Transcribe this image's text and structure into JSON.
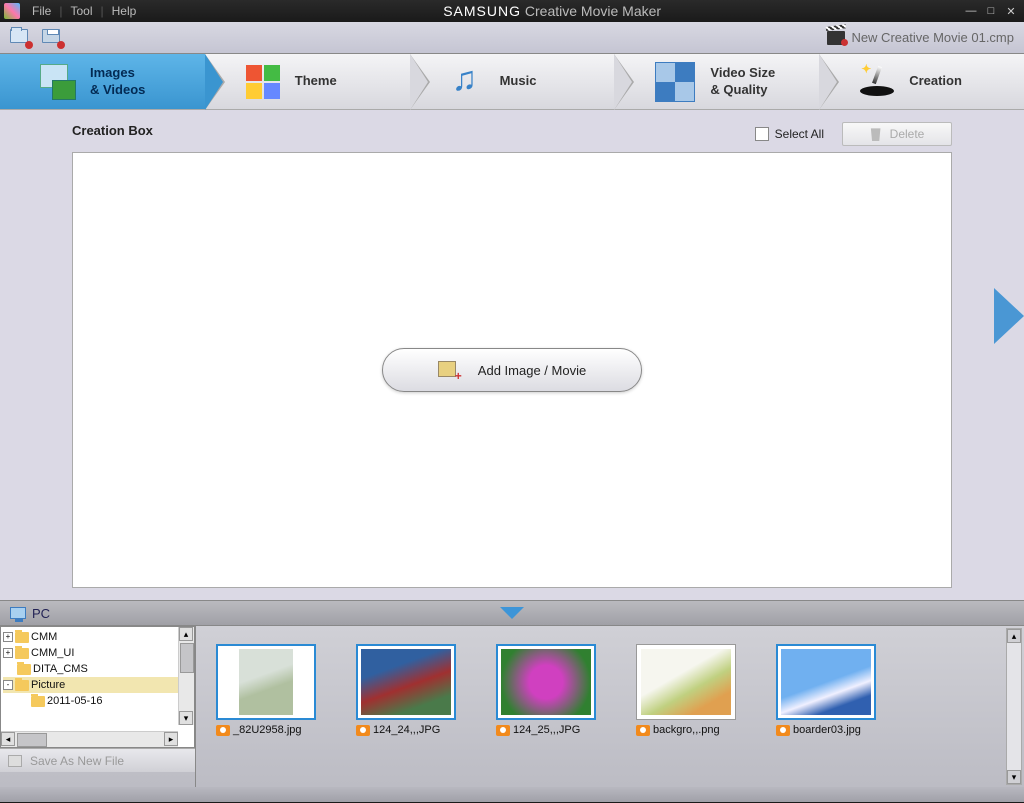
{
  "menu": {
    "file": "File",
    "tool": "Tool",
    "help": "Help"
  },
  "title": {
    "brand": "SAMSUNG",
    "app": "Creative Movie Maker"
  },
  "project_name": "New Creative Movie 01.cmp",
  "steps": [
    {
      "label": "Images\n& Videos"
    },
    {
      "label": "Theme"
    },
    {
      "label": "Music"
    },
    {
      "label": "Video Size\n& Quality"
    },
    {
      "label": "Creation"
    }
  ],
  "section": {
    "title": "Creation Box"
  },
  "select_all": "Select All",
  "delete_btn": "Delete",
  "add_btn": "Add Image / Movie",
  "pc_label": "PC",
  "tree": [
    {
      "name": "CMM",
      "expand": "+"
    },
    {
      "name": "CMM_UI",
      "expand": "+"
    },
    {
      "name": "DITA_CMS",
      "expand": ""
    },
    {
      "name": "Picture",
      "expand": "-"
    },
    {
      "name": "2011-05-16",
      "expand": "",
      "child": true
    }
  ],
  "save_as": "Save As New File",
  "thumbs": [
    {
      "name": "_82U2958.jpg",
      "sel": true,
      "bg": "linear-gradient(160deg,#d8e0d8 40%,#b0c0a0 60%)"
    },
    {
      "name": "124_24,,,JPG",
      "sel": true,
      "bg": "linear-gradient(160deg,#3060a0 30%,#a03030 55%,#4a7a4a 80%)"
    },
    {
      "name": "124_25,,,JPG",
      "sel": true,
      "bg": "radial-gradient(circle,#d040c0 30%,#308030 80%)"
    },
    {
      "name": "backgro,,.png",
      "sel": false,
      "bg": "linear-gradient(150deg,#f6f6ef 40%,#c0d080 60%,#e0a050 80%)"
    },
    {
      "name": "boarder03.jpg",
      "sel": true,
      "bg": "linear-gradient(160deg,#70b0f0 50%,#f0f0ff 65%,#3060b0 80%)"
    }
  ]
}
